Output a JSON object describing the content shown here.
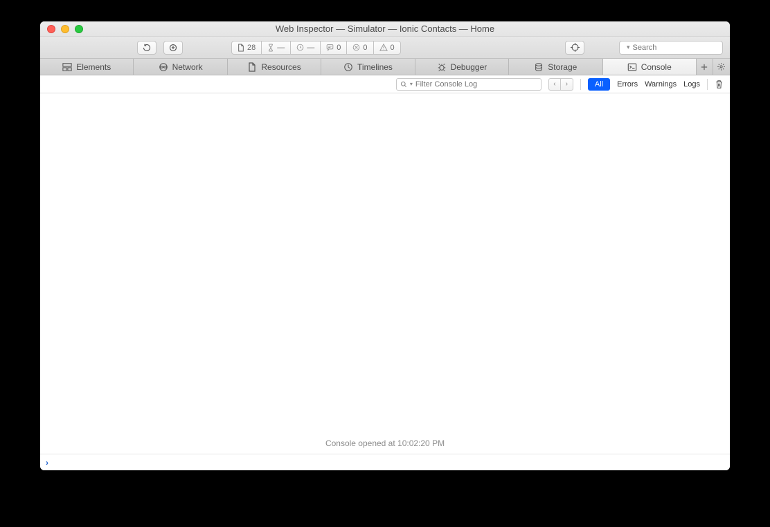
{
  "window": {
    "title": "Web Inspector — Simulator — Ionic Contacts — Home"
  },
  "toolbar": {
    "doc_count": "28",
    "timer_dash1": "—",
    "timer_dash2": "—",
    "comments": "0",
    "errors": "0",
    "warnings": "0",
    "search_placeholder": "Search"
  },
  "tabs": {
    "elements": "Elements",
    "network": "Network",
    "resources": "Resources",
    "timelines": "Timelines",
    "debugger": "Debugger",
    "storage": "Storage",
    "console": "Console"
  },
  "filterbar": {
    "placeholder": "Filter Console Log",
    "all": "All",
    "errors": "Errors",
    "warnings": "Warnings",
    "logs": "Logs"
  },
  "content": {
    "opened_message": "Console opened at 10:02:20 PM"
  }
}
